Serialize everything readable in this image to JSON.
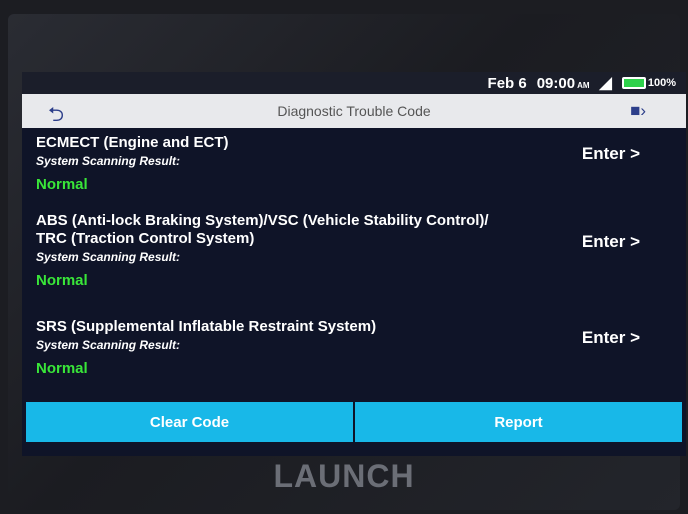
{
  "status_bar": {
    "date": "Feb 6",
    "time": "09:00",
    "ampm": "AM",
    "battery": "100%",
    "wifi_icon": "wifi-icon",
    "battery_icon": "battery-icon"
  },
  "header": {
    "title": "Diagnostic Trouble Code",
    "back_icon": "back-arrow-icon",
    "exit_icon": "exit-icon"
  },
  "systems": [
    {
      "name": "ECMECT (Engine and ECT)",
      "scan_label": "System Scanning Result:",
      "status": "Normal",
      "enter": "Enter >"
    },
    {
      "name_line1": "ABS (Anti-lock Braking System)/VSC (Vehicle Stability Control)/",
      "name_line2": "TRC (Traction Control System)",
      "scan_label": "System Scanning Result:",
      "status": "Normal",
      "enter": "Enter >"
    },
    {
      "name": "SRS (Supplemental Inflatable Restraint System)",
      "scan_label": "System Scanning Result:",
      "status": "Normal",
      "enter": "Enter >"
    }
  ],
  "buttons": {
    "clear": "Clear Code",
    "report": "Report"
  },
  "brand": "LAUNCH",
  "colors": {
    "screen_bg": "#0f1428",
    "status_ok": "#39e639",
    "button_bg": "#18b8e8",
    "titlebar_bg": "#e8e9ec"
  }
}
